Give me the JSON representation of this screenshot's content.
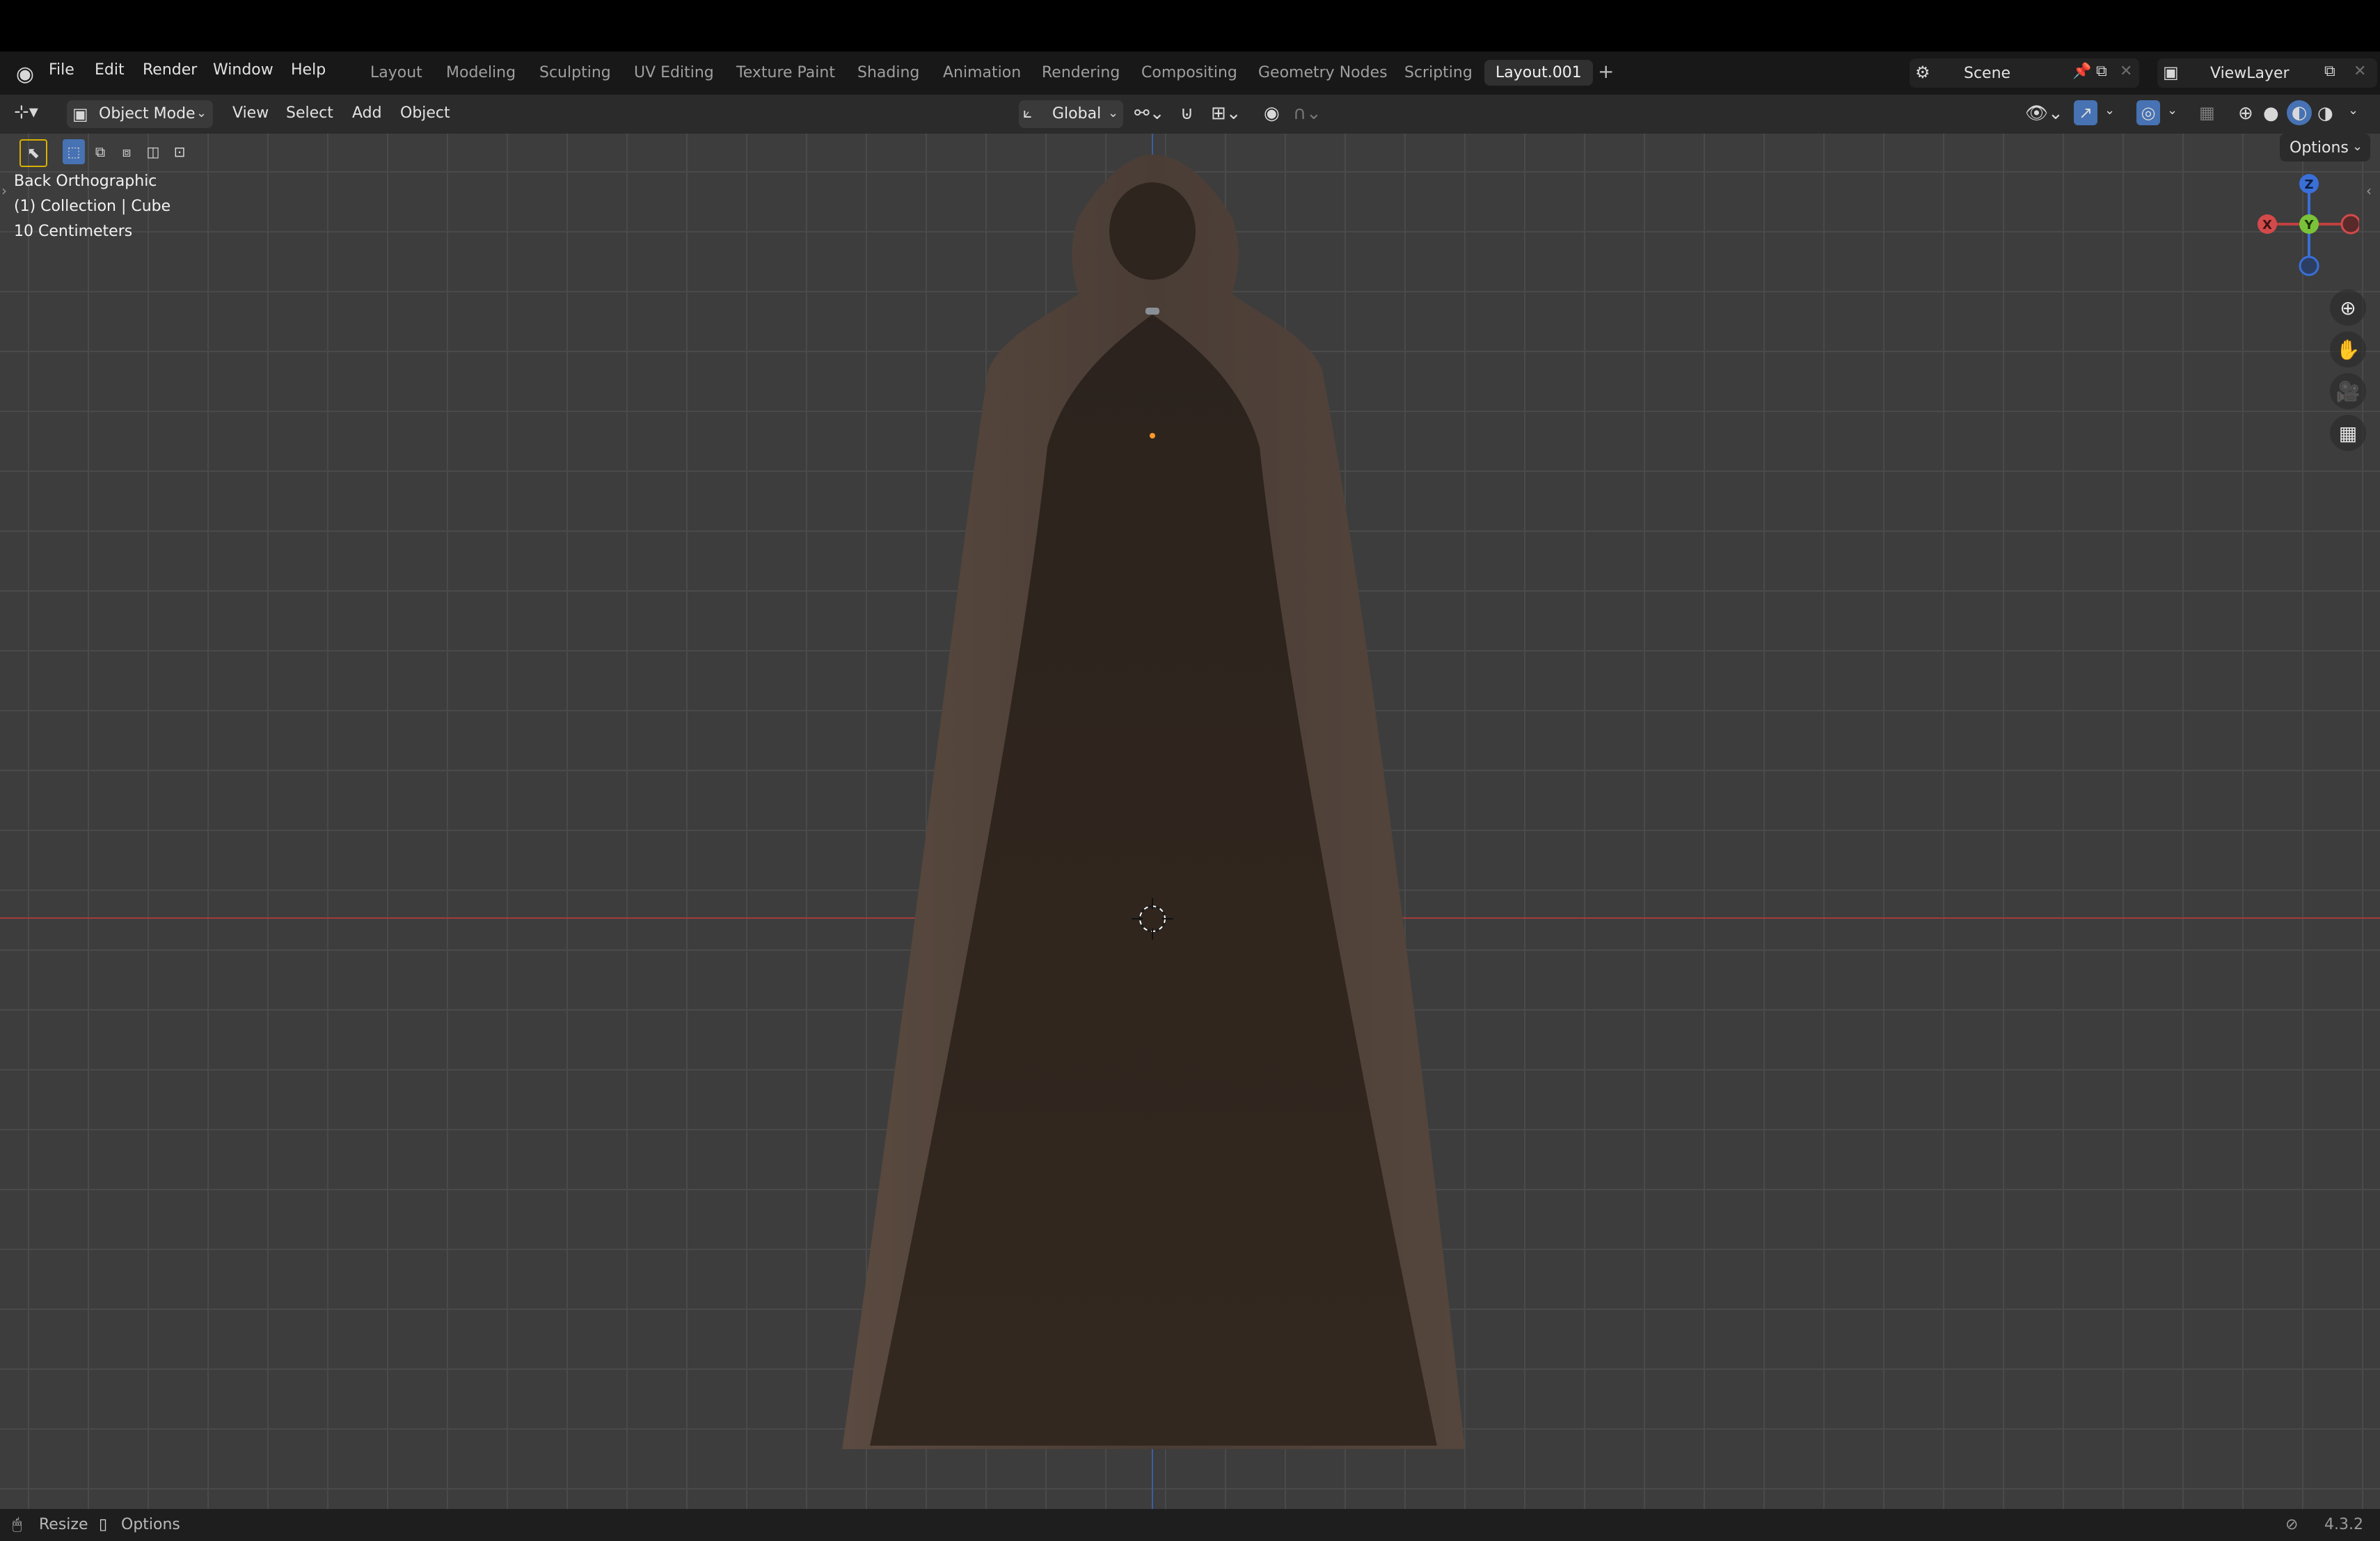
{
  "menubar": {
    "items": [
      "File",
      "Edit",
      "Render",
      "Window",
      "Help"
    ],
    "workspace_tabs": [
      "Layout",
      "Modeling",
      "Sculpting",
      "UV Editing",
      "Texture Paint",
      "Shading",
      "Animation",
      "Rendering",
      "Compositing",
      "Geometry Nodes",
      "Scripting",
      "Layout.001"
    ],
    "active_tab": "Layout.001",
    "add_tab": "+",
    "scene_name": "Scene",
    "view_layer": "ViewLayer"
  },
  "header": {
    "mode": "Object Mode",
    "menus": [
      "View",
      "Select",
      "Add",
      "Object"
    ],
    "transform_orientation": "Global",
    "options": "Options"
  },
  "viewport": {
    "view_name": "Back Orthographic",
    "collection_info": "(1) Collection | Cube",
    "scale_info": "10 Centimeters",
    "gizmo": {
      "z_label": "Z",
      "y_label": "Y",
      "x_label": "X"
    },
    "colors": {
      "background": "#3d3d3d",
      "grid": "#4a4a4a",
      "x_axis": "#a63a3a",
      "z_axis": "#3a5fa0",
      "cloak": "#3a2e26"
    }
  },
  "statusbar": {
    "left_items": [
      "Resize",
      "Options"
    ],
    "version": "4.3.2"
  }
}
